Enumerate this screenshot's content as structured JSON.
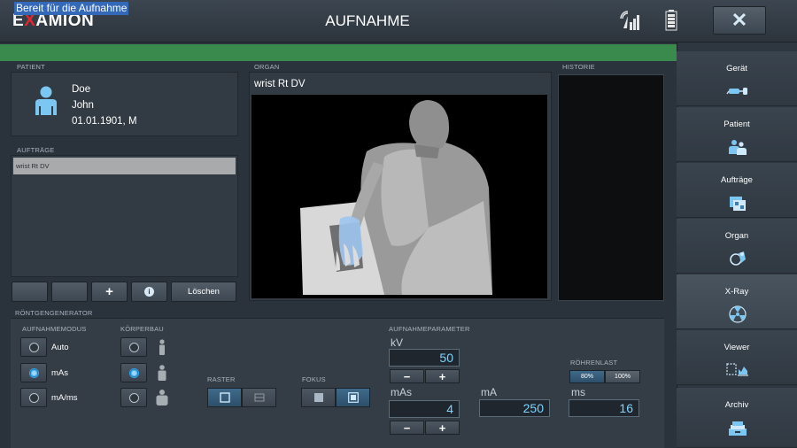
{
  "app": {
    "logo_left": "E",
    "logo_x": "X",
    "logo_rest": "AMION",
    "title": "AUFNAHME"
  },
  "status": {
    "text": "Bereit für die Aufnahme"
  },
  "sections": {
    "patient": "PATIENT",
    "organ": "ORGAN",
    "history": "HISTORIE",
    "orders": "AUFTRÄGE",
    "generator": "RÖNTGENGENERATOR",
    "mode": "AUFNAHMEMODUS",
    "build": "KÖRPERBAU",
    "grid": "RASTER",
    "focus": "FOKUS",
    "params": "AUFNAHMEPARAMETER",
    "tube_load": "RÖHRENLAST"
  },
  "patient": {
    "last_name": "Doe",
    "first_name": "John",
    "dob_sex": "01.01.1901, M"
  },
  "orders": {
    "items": [
      "wrist Rt DV"
    ],
    "add_label": "+",
    "info_label": "i",
    "delete_label": "Löschen"
  },
  "organ": {
    "title": "wrist Rt DV"
  },
  "mode": {
    "options": [
      "Auto",
      "mAs",
      "mA/ms"
    ],
    "selected": "mAs"
  },
  "body_build": {
    "selected_index": 1
  },
  "grid": {
    "selected": "with-grid"
  },
  "focus": {
    "selected": "small"
  },
  "params": {
    "kv_label": "kV",
    "kv_value": "50",
    "mas_label": "mAs",
    "mas_value": "4",
    "ma_label": "mA",
    "ma_value": "250",
    "ms_label": "ms",
    "ms_value": "16",
    "plus": "+",
    "minus": "−"
  },
  "tube_load": {
    "options": [
      "80%",
      "100%"
    ],
    "selected": "80%"
  },
  "nav": [
    {
      "label": "Gerät",
      "icon": "device-icon"
    },
    {
      "label": "Patient",
      "icon": "patients-icon"
    },
    {
      "label": "Aufträge",
      "icon": "orders-icon"
    },
    {
      "label": "Organ",
      "icon": "organ-icon"
    },
    {
      "label": "X-Ray",
      "icon": "radiation-icon"
    },
    {
      "label": "Viewer",
      "icon": "viewer-icon"
    },
    {
      "label": "Archiv",
      "icon": "archive-icon"
    }
  ],
  "nav_active": "X-Ray",
  "colors": {
    "accent": "#2ea6f0",
    "status_bar": "#3a8a4e",
    "logo_x": "#e3262e",
    "value_text": "#7fd3ff"
  }
}
